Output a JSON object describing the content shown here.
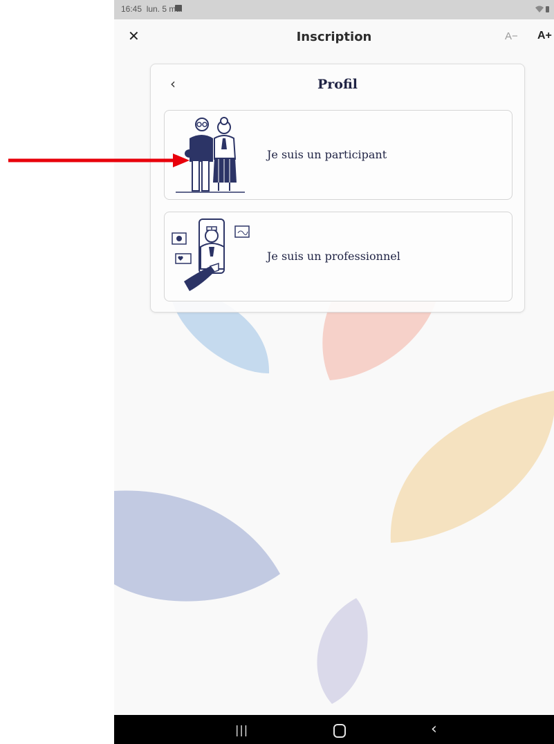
{
  "status_bar": {
    "time": "16:45",
    "date": "lun. 5 mai",
    "image_icon": "image-notification-icon",
    "right_icons": "wifi-icon battery-icon"
  },
  "app_bar": {
    "close_icon": "close-icon",
    "close_glyph": "✕",
    "title": "Inscription",
    "font_decrease": "A−",
    "font_increase": "A+"
  },
  "card": {
    "back_glyph": "‹",
    "title": "Profil",
    "options": [
      {
        "label": "Je suis un participant",
        "illustration": "elderly-couple-illustration"
      },
      {
        "label": "Je suis un professionnel",
        "illustration": "healthcare-professional-illustration"
      }
    ]
  },
  "nav_bar": {
    "recent_glyph": "|||",
    "back_glyph": "‹"
  },
  "colors": {
    "accent_navy": "#1f2344",
    "leaf_blue": "#c5daee",
    "leaf_pink": "#f6d1c9",
    "leaf_yellow": "#f5e2c0",
    "leaf_indigo": "#c2cae2",
    "leaf_lavender": "#dad9ea",
    "annotation_red": "#e8000b"
  }
}
